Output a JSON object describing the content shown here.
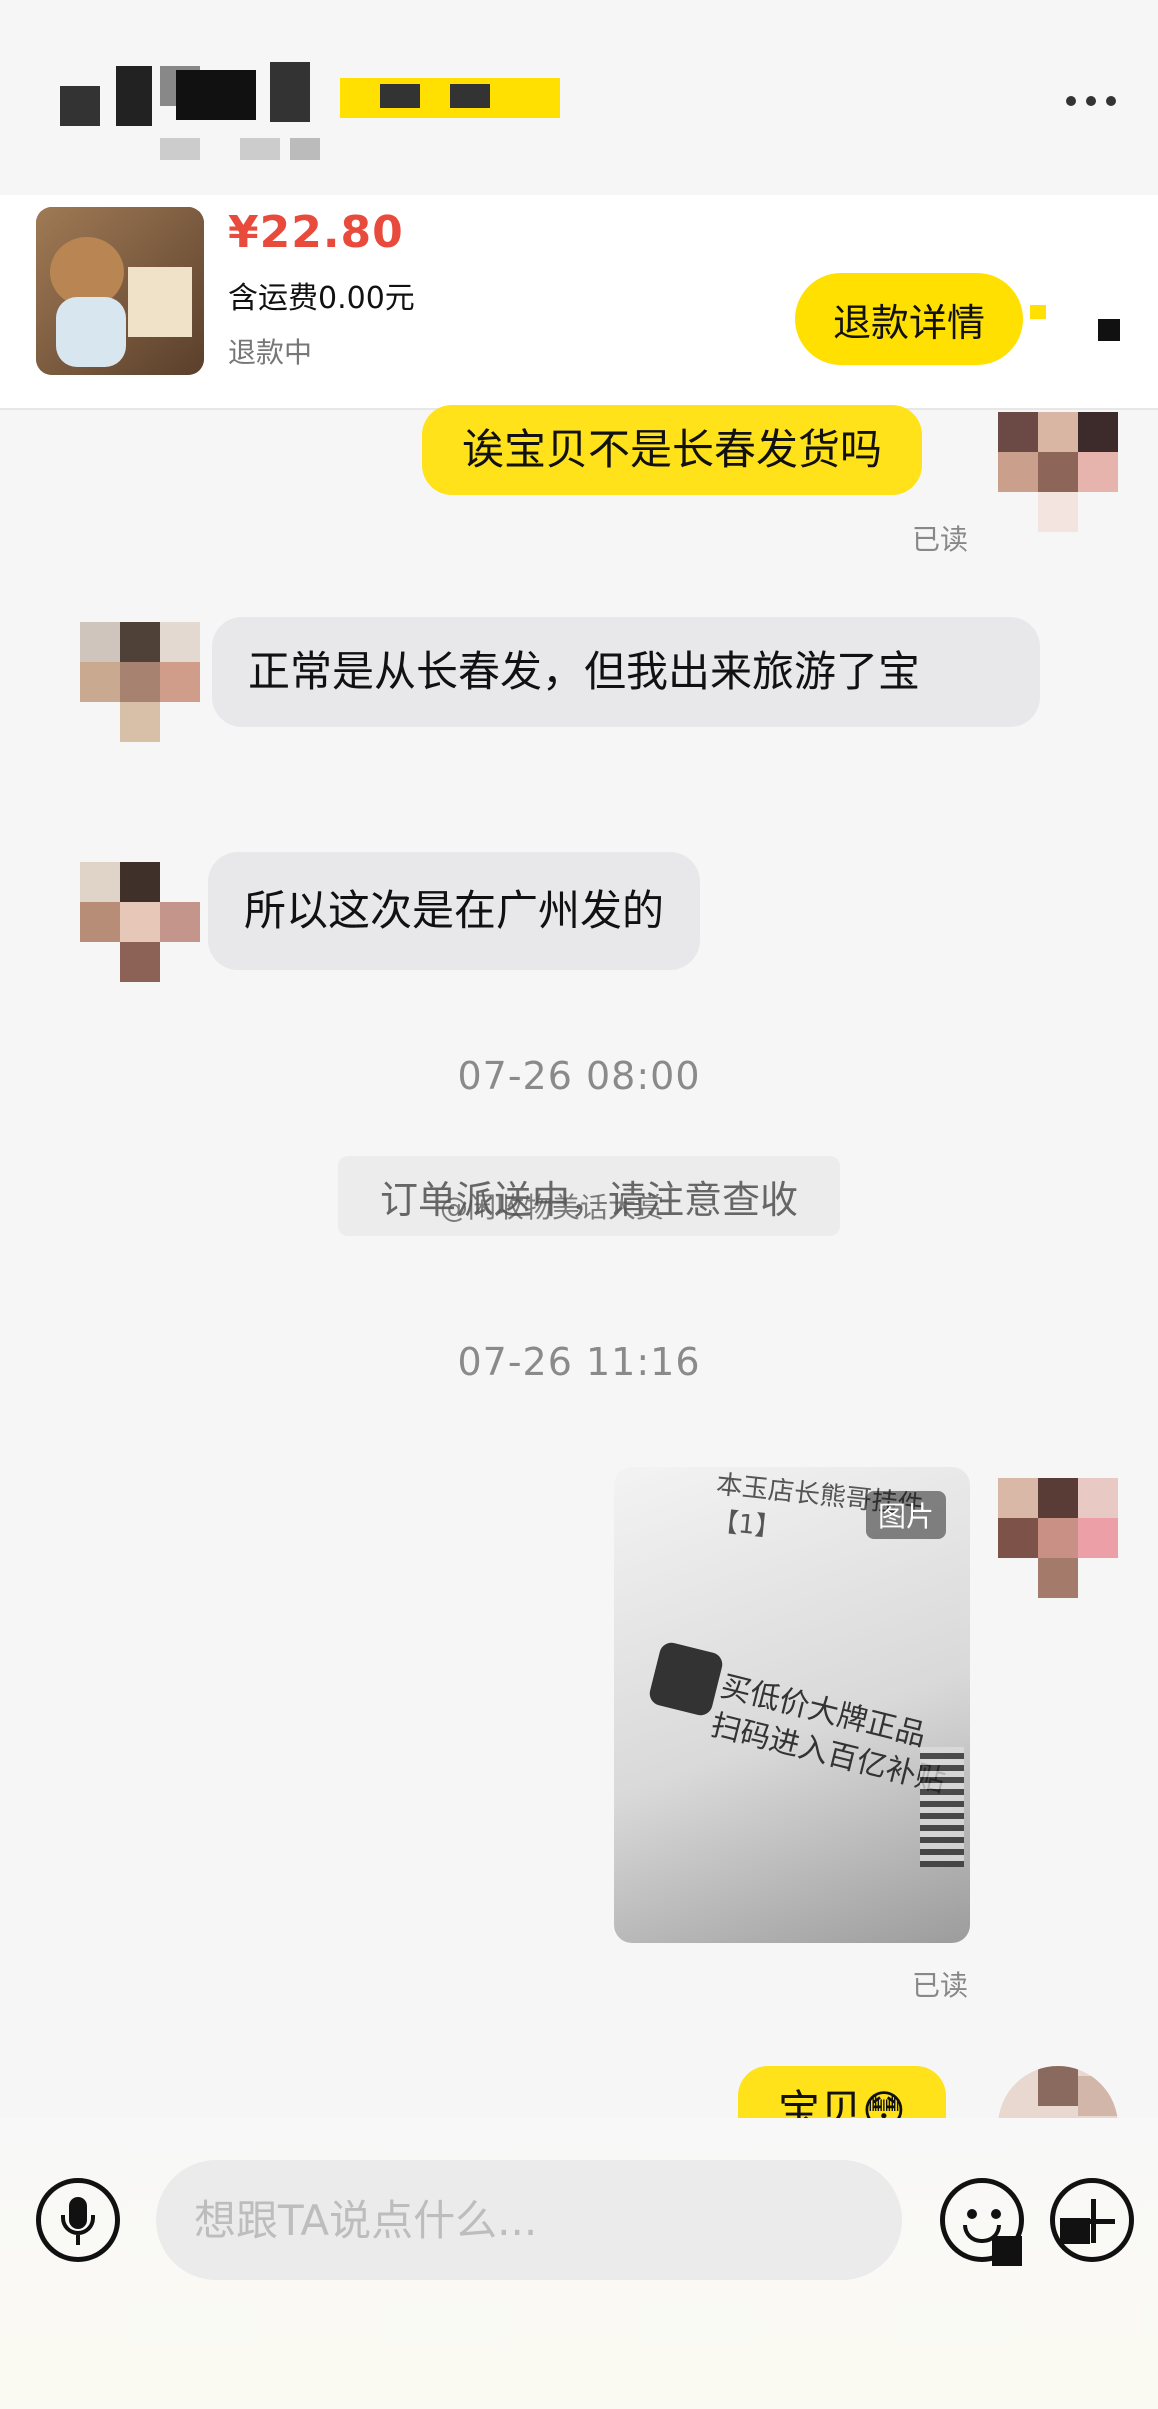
{
  "header": {
    "more_icon": "more-horizontal-icon"
  },
  "product": {
    "price": "¥22.80",
    "shipping": "含运费0.00元",
    "status": "退款中",
    "refund_button": "退款详情"
  },
  "messages": {
    "m1_text": "诶宝贝不是长春发货吗",
    "m1_read": "已读",
    "m2_text": "正常是从长春发，但我出来旅游了宝",
    "m3_text": "所以这次是在广州发的",
    "ts1": "07-26 08:00",
    "notice": "订单派送中，请注意查收",
    "watermark": "@闲收物美话大赏",
    "ts2": "07-26 11:16",
    "photo_badge": "图片",
    "photo_header": "本玉店长熊哥挂件【1】",
    "photo_line1": "买低价大牌正品",
    "photo_line2": "扫码进入百亿补贴",
    "m4_read": "已读",
    "m5_text": "宝贝😳"
  },
  "input_bar": {
    "placeholder": "想跟TA说点什么..."
  },
  "colors": {
    "accent_yellow": "#ffe000",
    "price_red": "#e84a3c"
  }
}
